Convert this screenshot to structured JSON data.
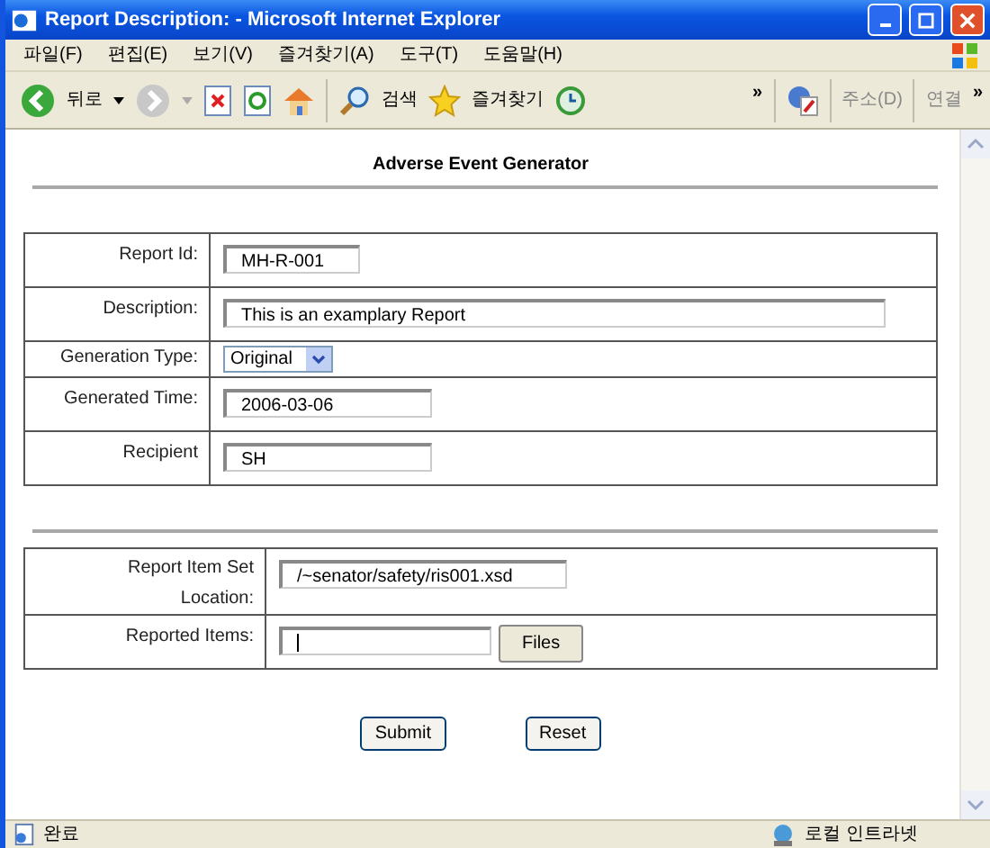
{
  "window": {
    "title": "Report Description: - Microsoft Internet Explorer"
  },
  "menu": [
    "파일(F)",
    "편집(E)",
    "보기(V)",
    "즐겨찾기(A)",
    "도구(T)",
    "도움말(H)"
  ],
  "toolbar": {
    "back": "뒤로",
    "search": "검색",
    "favorites": "즐겨찾기",
    "chevron": "»",
    "address": "주소(D)",
    "links": "연결",
    "links_chevron": "»"
  },
  "page": {
    "heading": "Adverse Event Generator",
    "form_1": [
      {
        "label": "Report Id:",
        "kind": "text",
        "value": "MH-R-001"
      },
      {
        "label": "Description:",
        "kind": "text",
        "value": "This is an examplary Report"
      },
      {
        "label": "Generation Type:",
        "kind": "select",
        "value": "Original"
      },
      {
        "label": "Generated Time:",
        "kind": "text",
        "value": "2006-03-06"
      },
      {
        "label": "Recipient",
        "kind": "text",
        "value": "SH"
      }
    ],
    "form_2": [
      {
        "label": "Report Item Set Location:",
        "kind": "text",
        "value": "/~senator/safety/ris001.xsd"
      },
      {
        "label": "Reported Items:",
        "kind": "file",
        "button": "Files"
      }
    ],
    "buttons": [
      "Submit",
      "Reset"
    ]
  },
  "status_bar": {
    "text": "완료",
    "zone": "로컬 인트라넷"
  }
}
